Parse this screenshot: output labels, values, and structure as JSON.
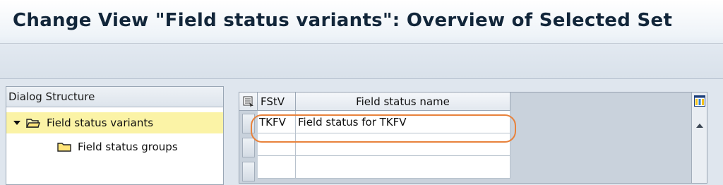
{
  "window": {
    "title": "Change View \"Field status variants\": Overview of Selected Set"
  },
  "dialog_structure": {
    "header": "Dialog Structure",
    "nodes": [
      {
        "label": "Field status variants",
        "selected": true,
        "expanded": true,
        "icon": "folder-open-icon"
      },
      {
        "label": "Field status groups",
        "selected": false,
        "icon": "folder-icon"
      }
    ]
  },
  "table": {
    "columns": [
      {
        "label": "FStV"
      },
      {
        "label": "Field status name"
      }
    ],
    "rows": [
      {
        "fstv": "TKFV",
        "name": "Field status for TKFV"
      },
      {
        "fstv": "",
        "name": ""
      },
      {
        "fstv": "",
        "name": ""
      }
    ]
  },
  "colors": {
    "selected_node_bg": "#fbf3a6",
    "highlight_outline": "#e8823c"
  }
}
